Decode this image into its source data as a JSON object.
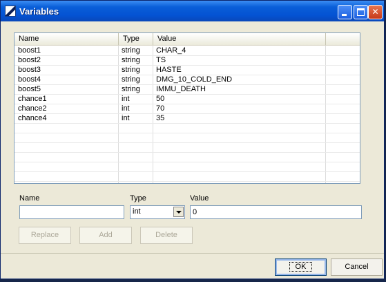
{
  "window": {
    "title": "Variables"
  },
  "list": {
    "columns": [
      "Name",
      "Type",
      "Value"
    ],
    "rows": [
      {
        "name": "boost1",
        "type": "string",
        "value": "CHAR_4"
      },
      {
        "name": "boost2",
        "type": "string",
        "value": "TS"
      },
      {
        "name": "boost3",
        "type": "string",
        "value": "HASTE"
      },
      {
        "name": "boost4",
        "type": "string",
        "value": "DMG_10_COLD_END"
      },
      {
        "name": "boost5",
        "type": "string",
        "value": "IMMU_DEATH"
      },
      {
        "name": "chance1",
        "type": "int",
        "value": "50"
      },
      {
        "name": "chance2",
        "type": "int",
        "value": "70"
      },
      {
        "name": "chance4",
        "type": "int",
        "value": "35"
      }
    ]
  },
  "form": {
    "name_label": "Name",
    "name_value": "",
    "type_label": "Type",
    "type_value": "int",
    "value_label": "Value",
    "value_value": "0"
  },
  "buttons": {
    "replace": "Replace",
    "add": "Add",
    "delete": "Delete",
    "ok": "OK",
    "cancel": "Cancel"
  }
}
